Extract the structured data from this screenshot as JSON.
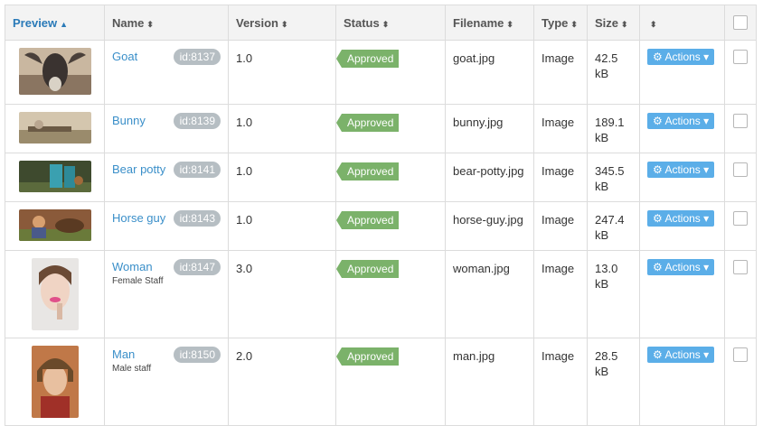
{
  "columns": {
    "preview": "Preview",
    "name": "Name",
    "version": "Version",
    "status": "Status",
    "filename": "Filename",
    "type": "Type",
    "size": "Size"
  },
  "sort_icons": {
    "asc": "▲",
    "both": "⬍"
  },
  "actions_label": "Actions",
  "rows": [
    {
      "name": "Goat",
      "id": "id:8137",
      "subtitle": "",
      "version": "1.0",
      "status": "Approved",
      "filename": "goat.jpg",
      "type": "Image",
      "size": "42.5 kB"
    },
    {
      "name": "Bunny",
      "id": "id:8139",
      "subtitle": "",
      "version": "1.0",
      "status": "Approved",
      "filename": "bunny.jpg",
      "type": "Image",
      "size": "189.1 kB"
    },
    {
      "name": "Bear potty",
      "id": "id:8141",
      "subtitle": "",
      "version": "1.0",
      "status": "Approved",
      "filename": "bear-potty.jpg",
      "type": "Image",
      "size": "345.5 kB"
    },
    {
      "name": "Horse guy",
      "id": "id:8143",
      "subtitle": "",
      "version": "1.0",
      "status": "Approved",
      "filename": "horse-guy.jpg",
      "type": "Image",
      "size": "247.4 kB"
    },
    {
      "name": "Woman",
      "id": "id:8147",
      "subtitle": "Female Staff",
      "version": "3.0",
      "status": "Approved",
      "filename": "woman.jpg",
      "type": "Image",
      "size": "13.0 kB"
    },
    {
      "name": "Man",
      "id": "id:8150",
      "subtitle": "Male staff",
      "version": "2.0",
      "status": "Approved",
      "filename": "man.jpg",
      "type": "Image",
      "size": "28.5 kB"
    }
  ],
  "colors": {
    "link": "#3a8fc9",
    "badge": "#b6bec3",
    "status": "#7bb26a",
    "actions": "#5baee8",
    "header": "#f3f3f3"
  }
}
